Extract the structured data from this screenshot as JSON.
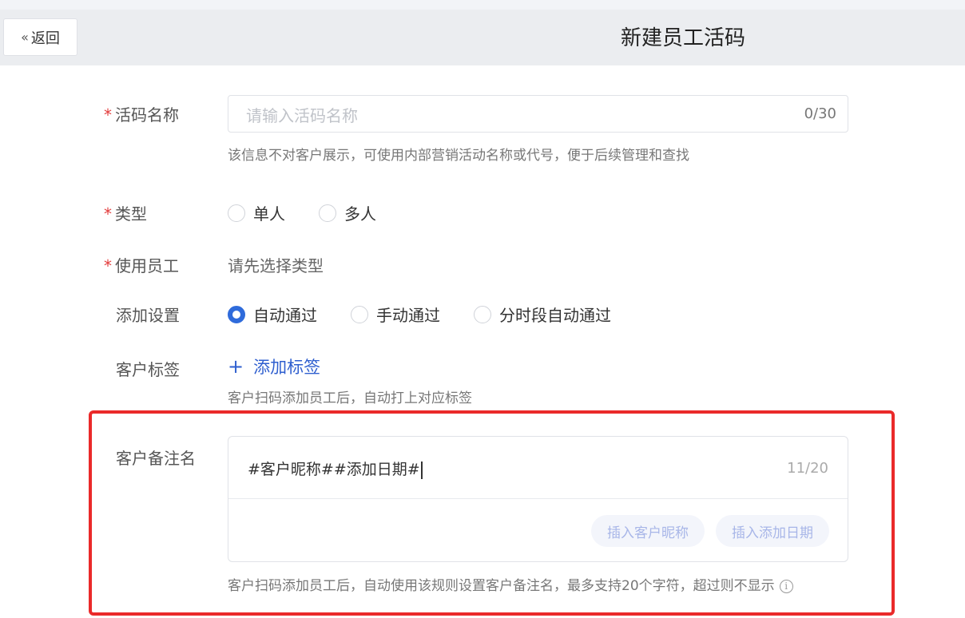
{
  "header": {
    "back_label": "返回",
    "title": "新建员工活码"
  },
  "form": {
    "code_name": {
      "label": "活码名称",
      "placeholder": "请输入活码名称",
      "counter": "0/30",
      "hint": "该信息不对客户展示，可使用内部营销活动名称或代号，便于后续管理和查找"
    },
    "type": {
      "label": "类型",
      "options": [
        "单人",
        "多人"
      ]
    },
    "staff": {
      "label": "使用员工",
      "value": "请先选择类型"
    },
    "add_setting": {
      "label": "添加设置",
      "options": [
        "自动通过",
        "手动通过",
        "分时段自动通过"
      ],
      "selected": "自动通过"
    },
    "customer_tag": {
      "label": "客户标签",
      "add_label": "添加标签",
      "hint": "客户扫码添加员工后，自动打上对应标签"
    },
    "remark": {
      "label": "客户备注名",
      "value": "#客户昵称##添加日期#",
      "counter": "11/20",
      "insert_nickname": "插入客户昵称",
      "insert_date": "插入添加日期",
      "hint": "客户扫码添加员工后，自动使用该规则设置客户备注名，最多支持20个字符，超过则不显示"
    }
  },
  "colors": {
    "accent": "#2f6bdb",
    "required": "#e23c3c",
    "highlight_border": "#ea2a2a"
  }
}
